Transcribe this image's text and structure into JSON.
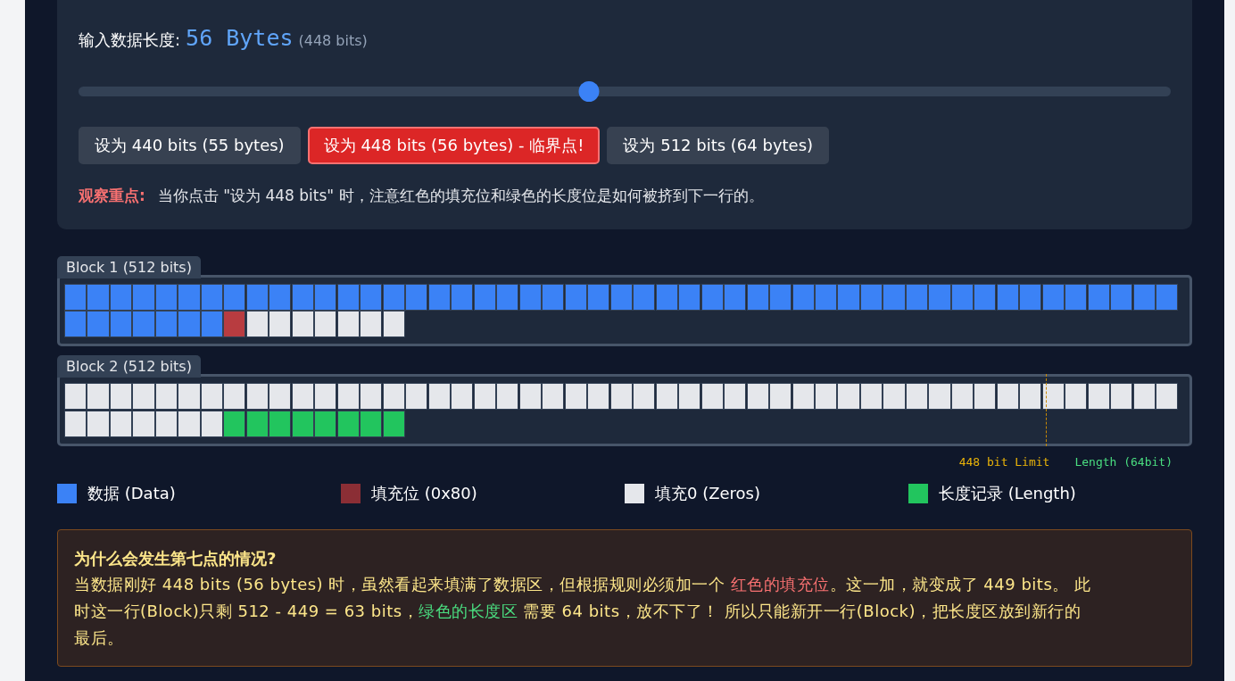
{
  "control": {
    "label": "输入数据长度:",
    "value": "56 Bytes",
    "bits": "(448 bits)",
    "slider": {
      "level": 0.467
    },
    "presets": [
      {
        "label": "设为 440 bits (55 bytes)",
        "selected": false
      },
      {
        "label": "设为 448 bits (56 bytes) - 临界点!",
        "selected": true
      },
      {
        "label": "设为 512 bits (64 bytes)",
        "selected": false
      }
    ],
    "note_label": "观察重点:",
    "note": "当你点击 \"设为 448 bits\" 时，注意红色的填充位和绿色的长度位是如何被挤到下一行的。"
  },
  "blocks": [
    {
      "title": "Block 1 (512 bits)",
      "cells": [
        {
          "kind": "data"
        },
        {
          "kind": "data"
        },
        {
          "kind": "data"
        },
        {
          "kind": "data"
        },
        {
          "kind": "data"
        },
        {
          "kind": "data"
        },
        {
          "kind": "data"
        },
        {
          "kind": "data"
        },
        {
          "kind": "data"
        },
        {
          "kind": "data"
        },
        {
          "kind": "data"
        },
        {
          "kind": "data"
        },
        {
          "kind": "data"
        },
        {
          "kind": "data"
        },
        {
          "kind": "data"
        },
        {
          "kind": "data"
        },
        {
          "kind": "data"
        },
        {
          "kind": "data"
        },
        {
          "kind": "data"
        },
        {
          "kind": "data"
        },
        {
          "kind": "data"
        },
        {
          "kind": "data"
        },
        {
          "kind": "data"
        },
        {
          "kind": "data"
        },
        {
          "kind": "data"
        },
        {
          "kind": "data"
        },
        {
          "kind": "data"
        },
        {
          "kind": "data"
        },
        {
          "kind": "data"
        },
        {
          "kind": "data"
        },
        {
          "kind": "data"
        },
        {
          "kind": "data"
        },
        {
          "kind": "data"
        },
        {
          "kind": "data"
        },
        {
          "kind": "data"
        },
        {
          "kind": "data"
        },
        {
          "kind": "data"
        },
        {
          "kind": "data"
        },
        {
          "kind": "data"
        },
        {
          "kind": "data"
        },
        {
          "kind": "data"
        },
        {
          "kind": "data"
        },
        {
          "kind": "data"
        },
        {
          "kind": "data"
        },
        {
          "kind": "data"
        },
        {
          "kind": "data"
        },
        {
          "kind": "data"
        },
        {
          "kind": "data"
        },
        {
          "kind": "data"
        },
        {
          "kind": "data"
        },
        {
          "kind": "data"
        },
        {
          "kind": "data"
        },
        {
          "kind": "data"
        },
        {
          "kind": "data"
        },
        {
          "kind": "data"
        },
        {
          "kind": "data"
        },
        {
          "kind": "padding"
        },
        {
          "kind": "zero"
        },
        {
          "kind": "zero"
        },
        {
          "kind": "zero"
        },
        {
          "kind": "zero"
        },
        {
          "kind": "zero"
        },
        {
          "kind": "zero"
        },
        {
          "kind": "zero"
        }
      ]
    },
    {
      "title": "Block 2 (512 bits)",
      "limit_line": true,
      "cells": [
        {
          "kind": "zero"
        },
        {
          "kind": "zero"
        },
        {
          "kind": "zero"
        },
        {
          "kind": "zero"
        },
        {
          "kind": "zero"
        },
        {
          "kind": "zero"
        },
        {
          "kind": "zero"
        },
        {
          "kind": "zero"
        },
        {
          "kind": "zero"
        },
        {
          "kind": "zero"
        },
        {
          "kind": "zero"
        },
        {
          "kind": "zero"
        },
        {
          "kind": "zero"
        },
        {
          "kind": "zero"
        },
        {
          "kind": "zero"
        },
        {
          "kind": "zero"
        },
        {
          "kind": "zero"
        },
        {
          "kind": "zero"
        },
        {
          "kind": "zero"
        },
        {
          "kind": "zero"
        },
        {
          "kind": "zero"
        },
        {
          "kind": "zero"
        },
        {
          "kind": "zero"
        },
        {
          "kind": "zero"
        },
        {
          "kind": "zero"
        },
        {
          "kind": "zero"
        },
        {
          "kind": "zero"
        },
        {
          "kind": "zero"
        },
        {
          "kind": "zero"
        },
        {
          "kind": "zero"
        },
        {
          "kind": "zero"
        },
        {
          "kind": "zero"
        },
        {
          "kind": "zero"
        },
        {
          "kind": "zero"
        },
        {
          "kind": "zero"
        },
        {
          "kind": "zero"
        },
        {
          "kind": "zero"
        },
        {
          "kind": "zero"
        },
        {
          "kind": "zero"
        },
        {
          "kind": "zero"
        },
        {
          "kind": "zero"
        },
        {
          "kind": "zero"
        },
        {
          "kind": "zero"
        },
        {
          "kind": "zero"
        },
        {
          "kind": "zero"
        },
        {
          "kind": "zero"
        },
        {
          "kind": "zero"
        },
        {
          "kind": "zero"
        },
        {
          "kind": "zero"
        },
        {
          "kind": "zero"
        },
        {
          "kind": "zero"
        },
        {
          "kind": "zero"
        },
        {
          "kind": "zero"
        },
        {
          "kind": "zero"
        },
        {
          "kind": "zero"
        },
        {
          "kind": "zero"
        },
        {
          "kind": "length"
        },
        {
          "kind": "length"
        },
        {
          "kind": "length"
        },
        {
          "kind": "length"
        },
        {
          "kind": "length"
        },
        {
          "kind": "length"
        },
        {
          "kind": "length"
        },
        {
          "kind": "length"
        }
      ]
    }
  ],
  "markers": {
    "limit": "448 bit Limit",
    "length": "Length (64bit)"
  },
  "legend": [
    {
      "label": "数据 (Data)",
      "color": "#3b82f6"
    },
    {
      "label": "填充位 (0x80)",
      "color": "#8b2e35"
    },
    {
      "label": "填充0 (Zeros)",
      "color": "#e5e7eb"
    },
    {
      "label": "长度记录 (Length)",
      "color": "#22c55e"
    }
  ],
  "explanation": {
    "title": "为什么会发生第七点的情况?",
    "segments": [
      {
        "kind": "text",
        "text": "当数据刚好 448 bits (56 bytes) 时，虽然看起来填满了数据区，但根据规则必须加一个 "
      },
      {
        "kind": "padding",
        "text": "红色的填充位"
      },
      {
        "kind": "text",
        "text": "。这一加，就变成了 449 bits。 此时这一行(Block)只剩 512 - 449 = 63 bits，"
      },
      {
        "kind": "length",
        "text": "绿色的长度区"
      },
      {
        "kind": "text",
        "text": " 需要 64 bits，放不下了！ 所以只能新开一行(Block)，把长度区放到新行的最后。"
      }
    ]
  }
}
